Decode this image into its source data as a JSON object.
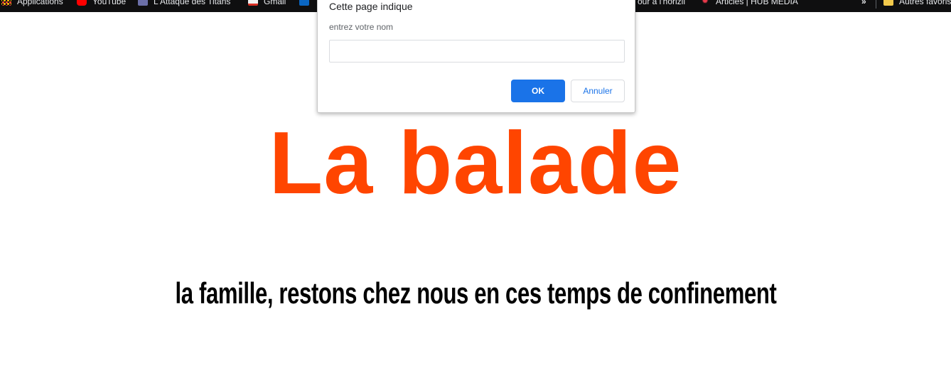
{
  "bookmarks": {
    "apps": "Applications",
    "youtube": "YouTube",
    "attaque": "L'Attaque des Titans",
    "gmail": "Gmail",
    "linkedin": "",
    "tour": "our à l'horizil",
    "articles": "Articles | HUB MEDIA",
    "more": "»",
    "others": "Autres favoris"
  },
  "page": {
    "title": "La balade",
    "subtitle": "la famille, restons chez nous en ces temps de confinement"
  },
  "dialog": {
    "title": "Cette page indique",
    "message": "entrez votre nom",
    "input_value": "",
    "ok_label": "OK",
    "cancel_label": "Annuler"
  },
  "colors": {
    "title": "#ff4500",
    "subtitle": "#000000",
    "ok_button": "#1a73e8",
    "bookmarks_bar": "#0f0f10"
  }
}
